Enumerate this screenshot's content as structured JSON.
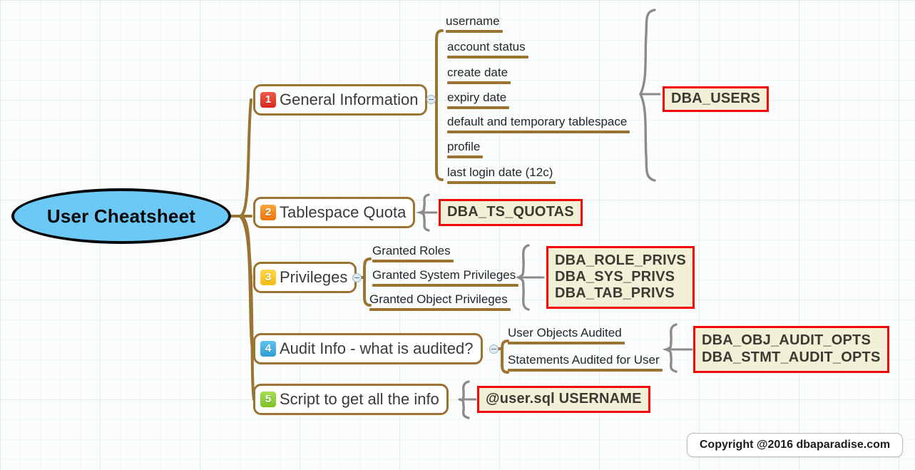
{
  "title": "User Cheatsheet",
  "root": {
    "label": "User Cheatsheet",
    "fill_color": "#6cc8f4",
    "border_color": "#05060a"
  },
  "colors": {
    "branch_border": "#9b7434",
    "ref_border": "#f40606",
    "ref_fill": "#f2f0d6",
    "brace": "#8b8b8b",
    "badge_1": "#d8291a",
    "badge_2": "#ee7407",
    "badge_3": "#f5bc10",
    "badge_4": "#2f9fd4",
    "badge_5": "#7dc225"
  },
  "branches": [
    {
      "number": "1",
      "label": "General Information",
      "children": [
        "username",
        "account status",
        "create date",
        "expiry date",
        "default and temporary tablespace",
        "profile",
        "last login date (12c)"
      ],
      "refs": [
        "DBA_USERS"
      ]
    },
    {
      "number": "2",
      "label": "Tablespace Quota",
      "children": [],
      "refs": [
        "DBA_TS_QUOTAS"
      ]
    },
    {
      "number": "3",
      "label": "Privileges",
      "children": [
        "Granted Roles",
        "Granted System Privileges",
        "Granted Object Privileges"
      ],
      "refs": [
        "DBA_ROLE_PRIVS",
        "DBA_SYS_PRIVS",
        "DBA_TAB_PRIVS"
      ]
    },
    {
      "number": "4",
      "label": "Audit Info - what is audited?",
      "children": [
        "User Objects Audited",
        "Statements Audited for User"
      ],
      "refs": [
        "DBA_OBJ_AUDIT_OPTS",
        "DBA_STMT_AUDIT_OPTS"
      ]
    },
    {
      "number": "5",
      "label": "Script to get all the info",
      "children": [],
      "refs": [
        "@user.sql USERNAME"
      ]
    }
  ],
  "footer": {
    "text": "Copyright @2016 dbaparadise.com"
  }
}
